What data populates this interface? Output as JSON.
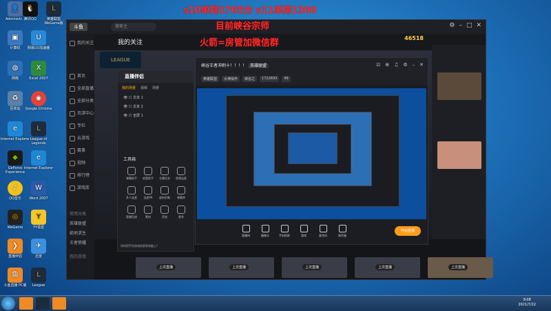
{
  "overlay": {
    "line1": "s10单排1765分  s11单排1300",
    "line2": "目前峡谷宗师",
    "line3": "火箭=房管加微信群"
  },
  "desktop_icons": [
    {
      "label": "Administr...",
      "icon": "user-folder-icon"
    },
    {
      "label": "腾讯QQ",
      "icon": "qq-icon"
    },
    {
      "label": "英雄联盟 WeGame版",
      "icon": "lol-icon"
    },
    {
      "label": "计算机",
      "icon": "computer-icon"
    },
    {
      "label": "网易UU加速器",
      "icon": "uu-icon"
    },
    {
      "label": "网络",
      "icon": "network-icon"
    },
    {
      "label": "Excel 2007",
      "icon": "excel-icon"
    },
    {
      "label": "回收站",
      "icon": "recycle-bin-icon"
    },
    {
      "label": "Google Chrome",
      "icon": "chrome-icon"
    },
    {
      "label": "Internet Explorer",
      "icon": "ie-icon"
    },
    {
      "label": "League of Legends",
      "icon": "lol-icon"
    },
    {
      "label": "GeForce Experience",
      "icon": "nvidia-icon"
    },
    {
      "label": "Internet Explorer",
      "icon": "ie-icon"
    },
    {
      "label": "QQ音乐",
      "icon": "qqmusic-icon"
    },
    {
      "label": "Word 2007",
      "icon": "word-icon"
    },
    {
      "label": "WeGame",
      "icon": "wegame-icon"
    },
    {
      "label": "YY语音",
      "icon": "yy-icon"
    },
    {
      "label": "直播伴侣",
      "icon": "app-icon"
    },
    {
      "label": "迅雷",
      "icon": "xunlei-icon"
    },
    {
      "label": "斗鱼直播 PC版",
      "icon": "douyu-icon"
    },
    {
      "label": "League",
      "icon": "lol-icon"
    }
  ],
  "main": {
    "search_placeholder": "搜索主",
    "follow": "我的关注",
    "badge": "46518",
    "sidebar": [
      "我的关注",
      "首页",
      "全部直播",
      "全部分类",
      "页游中心",
      "专栏",
      "云游戏",
      "赛事",
      "视频",
      "排行榜",
      "游戏库",
      "常用分类",
      "英雄联盟",
      "绝地求生",
      "王者荣耀",
      "我的游戏"
    ],
    "bottom_cards": [
      "上次直播",
      "上次直播",
      "上次直播",
      "上次直播",
      "上次直播"
    ]
  },
  "tool": {
    "title": "直播伴侣",
    "tabs": [
      "我的场景",
      "视频",
      "场景"
    ],
    "scenes": [
      "文本 1",
      "文本 2",
      "全屏 1"
    ],
    "tools_title": "工具箱",
    "tools": [
      "弹幕助手",
      "房管助手",
      "主播任务",
      "视频连麦",
      "多人连麦",
      "连麦PK",
      "虚拟形象",
      "弹幕库",
      "直播回放",
      "素材",
      "音效",
      "更多"
    ],
    "footer": "如何把手机游戏投屏到电脑上？"
  },
  "broadcast": {
    "title": "峡谷王者冲刺十！！！！",
    "category": "英雄联盟",
    "tags": [
      "英雄联盟",
      "大神操作",
      "峡谷之",
      "1722693",
      "49"
    ],
    "bottom": [
      "直播间",
      "摄像头",
      "手机投屏",
      "游戏",
      "麦克风",
      "扬声器"
    ],
    "start": "开始直播"
  },
  "taskbar": {
    "time": "9:08",
    "date": "2021/7/22"
  }
}
